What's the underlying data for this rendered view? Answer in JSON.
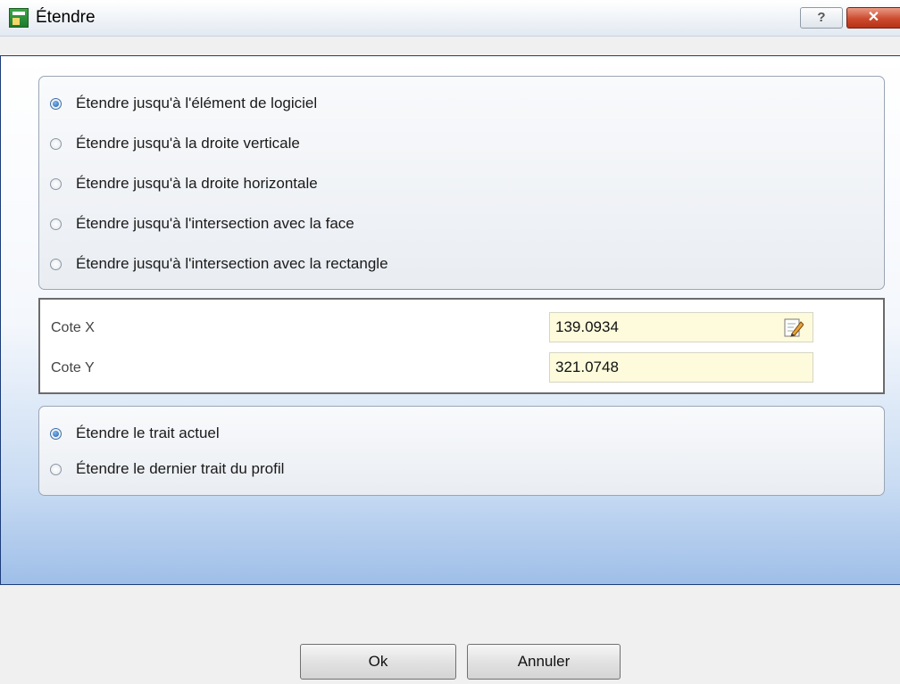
{
  "window": {
    "title": "Étendre",
    "help_label": "?",
    "close_label": "✕"
  },
  "extend_to_options": [
    {
      "label": "Étendre jusqu'à l'élément de logiciel",
      "selected": true
    },
    {
      "label": "Étendre jusqu'à la droite verticale",
      "selected": false
    },
    {
      "label": "Étendre jusqu'à la droite horizontale",
      "selected": false
    },
    {
      "label": "Étendre jusqu'à l'intersection avec la face",
      "selected": false
    },
    {
      "label": "Étendre jusqu'à l'intersection avec la rectangle",
      "selected": false
    }
  ],
  "coordinates": {
    "x_label": "Cote X",
    "x_value": "139.0934",
    "y_label": "Cote Y",
    "y_value": "321.0748",
    "edit_icon": "edit-pencil-icon"
  },
  "stroke_options": [
    {
      "label": "Étendre le trait actuel",
      "selected": true
    },
    {
      "label": "Étendre le dernier trait du profil",
      "selected": false
    }
  ],
  "buttons": {
    "ok_label": "Ok",
    "cancel_label": "Annuler"
  },
  "colors": {
    "panel_border": "#1c3d7a",
    "field_bg": "#fdfbdc",
    "close_red": "#cc4a2e"
  }
}
